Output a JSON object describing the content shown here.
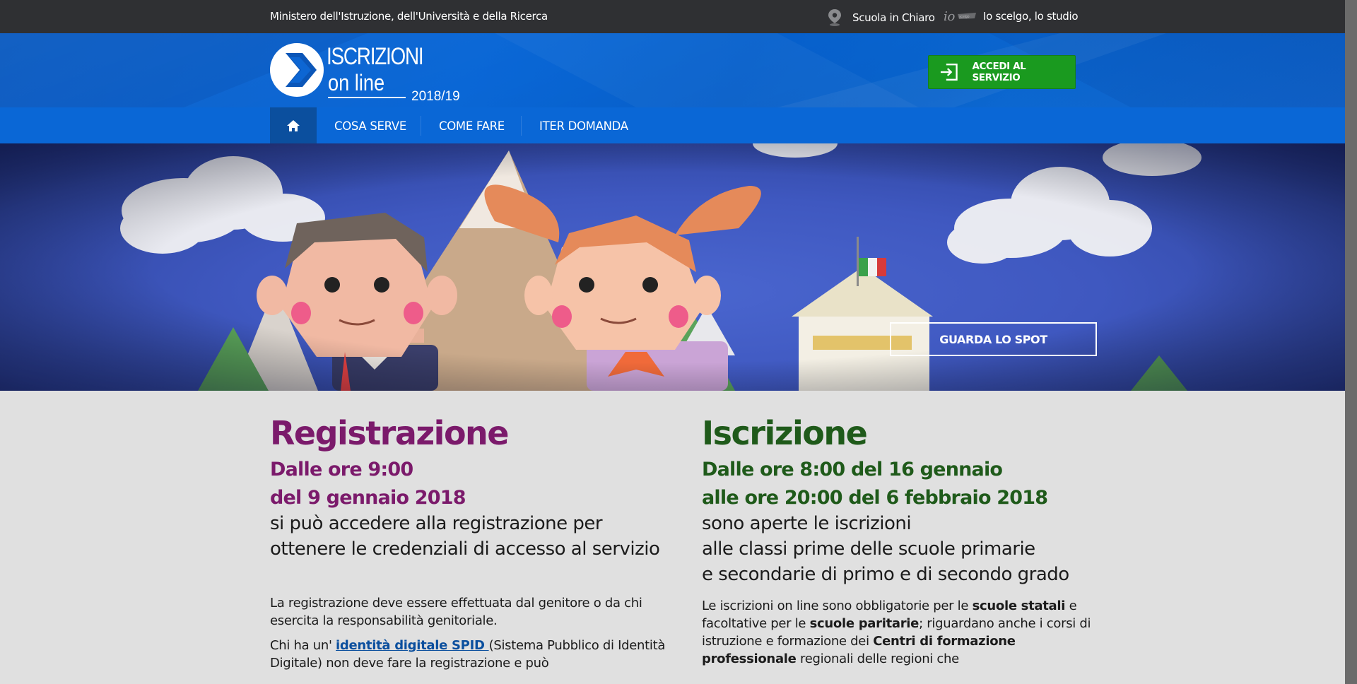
{
  "topbar": {
    "ministero": "Ministero dell'Istruzione, dell'Università e della Ricerca",
    "link_scuola": "Scuola in Chiaro",
    "link_io": "Io scelgo, lo studio"
  },
  "header": {
    "logo_title": "ISCRIZIONI",
    "logo_sub": "on line",
    "logo_year": "2018/19",
    "accedi_label": "ACCEDI AL SERVIZIO"
  },
  "nav": {
    "items": [
      {
        "label": "COSA SERVE"
      },
      {
        "label": "COME FARE"
      },
      {
        "label": "ITER DOMANDA"
      }
    ]
  },
  "banner": {
    "spot_label": "GUARDA LO SPOT"
  },
  "registrazione": {
    "title": "Registrazione",
    "date1": "Dalle ore 9:00",
    "date2": "del 9 gennaio 2018",
    "lead1": "si può accedere alla registrazione per",
    "lead2": "ottenere le credenziali di accesso al servizio",
    "p1": "La registrazione deve essere effettuata dal genitore o da chi esercita la responsabilità genitoriale.",
    "p2_before": "Chi ha un' ",
    "p2_link": "identità digitale SPID ",
    "p2_after": "(Sistema Pubblico di Identità Digitale) non deve fare la registrazione e può"
  },
  "iscrizione": {
    "title": "Iscrizione",
    "date1": "Dalle ore 8:00 del 16 gennaio",
    "date2": "alle ore 20:00 del 6 febbraio 2018",
    "lead1": "sono aperte le iscrizioni",
    "lead2": "alle classi prime delle scuole primarie",
    "lead3": "e secondarie di primo e di secondo grado",
    "p1_a": "Le iscrizioni on line sono obbligatorie per le ",
    "p1_b": "scuole statali",
    "p1_c": " e facoltative per le ",
    "p1_d": "scuole paritarie",
    "p1_e": "; riguardano anche i corsi di istruzione e formazione dei ",
    "p1_f": "Centri di formazione professionale",
    "p1_g": " regionali delle regioni che"
  },
  "colors": {
    "topbar": "#2f3033",
    "header_blue": "#0a67d6",
    "home_tab": "#0b4f9e",
    "accedi_green": "#1a9a1f",
    "registrazione_purple": "#7b1a6b",
    "iscrizione_green": "#1f5a1a"
  }
}
